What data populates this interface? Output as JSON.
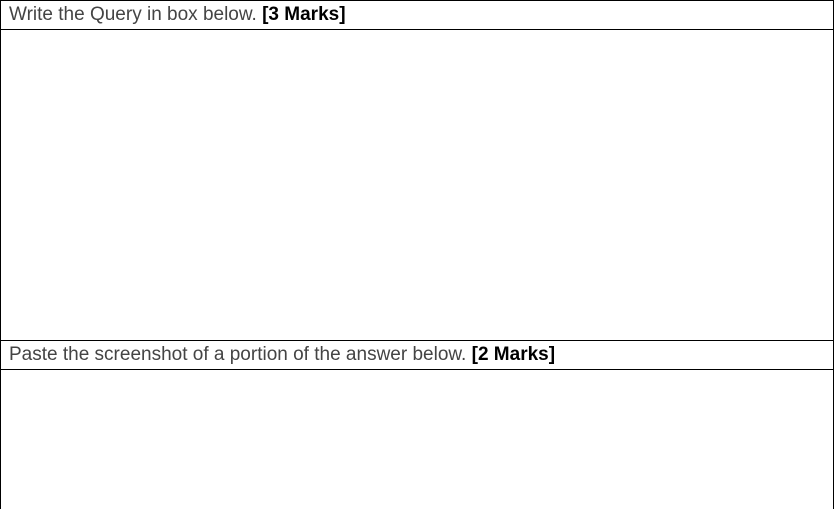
{
  "row1": {
    "text": "Write the Query in box below. ",
    "marks": "[3 Marks]"
  },
  "row2": {
    "text": ""
  },
  "row3": {
    "text": "Paste the screenshot of a portion of the answer below. ",
    "marks": "[2 Marks]"
  },
  "row4": {
    "text": ""
  }
}
